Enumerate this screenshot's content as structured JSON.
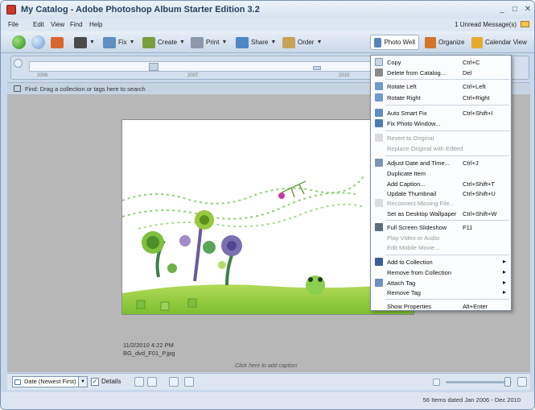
{
  "window": {
    "title": "My Catalog - Adobe Photoshop Album Starter Edition 3.2",
    "controls": [
      "_",
      "□",
      "✕"
    ]
  },
  "menubar": {
    "items": [
      "File",
      "Edit",
      "View",
      "Find",
      "Help"
    ],
    "unread": "1 Unread Message(s)"
  },
  "toolbar": {
    "fix": "Fix",
    "create": "Create",
    "print": "Print",
    "share": "Share",
    "order": "Order",
    "photo_well": "Photo Well",
    "organize": "Organize",
    "calendar_view": "Calendar View"
  },
  "timeline": {
    "years": [
      "2006",
      "2007",
      "2010"
    ]
  },
  "find": {
    "text": "Find: Drag a collection or tags here to search"
  },
  "photo": {
    "date": "11/2/2010 4:22 PM",
    "filename": "BG_dvd_F01_P.jpg",
    "caption_prompt": "Click here to add caption"
  },
  "bottombar": {
    "sort": "Date (Newest First)",
    "details": "Details",
    "details_checked": "✓"
  },
  "status": {
    "text": "56 Items dated Jan 2006 - Dec 2010"
  },
  "context_menu": {
    "items": [
      {
        "label": "Copy",
        "shortcut": "Ctrl+C",
        "enabled": true
      },
      {
        "label": "Delete from Catalog...",
        "shortcut": "Del",
        "enabled": true
      },
      {
        "label": "Rotate Left",
        "shortcut": "Ctrl+Left",
        "enabled": true
      },
      {
        "label": "Rotate Right",
        "shortcut": "Ctrl+Right",
        "enabled": true
      },
      {
        "label": "Auto Smart Fix",
        "shortcut": "Ctrl+Shift+I",
        "enabled": true
      },
      {
        "label": "Fix Photo Window...",
        "shortcut": "",
        "enabled": true
      },
      {
        "label": "Revert to Original",
        "shortcut": "",
        "enabled": false
      },
      {
        "label": "Replace Original with Edited",
        "shortcut": "",
        "enabled": false
      },
      {
        "label": "Adjust Date and Time...",
        "shortcut": "Ctrl+J",
        "enabled": true
      },
      {
        "label": "Duplicate Item",
        "shortcut": "",
        "enabled": true
      },
      {
        "label": "Add Caption...",
        "shortcut": "Ctrl+Shift+T",
        "enabled": true
      },
      {
        "label": "Update Thumbnail",
        "shortcut": "Ctrl+Shift+U",
        "enabled": true
      },
      {
        "label": "Reconnect Missing File...",
        "shortcut": "",
        "enabled": false
      },
      {
        "label": "Set as Desktop Wallpaper",
        "shortcut": "Ctrl+Shift+W",
        "enabled": true
      },
      {
        "label": "Full Screen Slideshow",
        "shortcut": "F11",
        "enabled": true
      },
      {
        "label": "Play Video or Audio",
        "shortcut": "",
        "enabled": false
      },
      {
        "label": "Edit Mobile Movie...",
        "shortcut": "",
        "enabled": false
      },
      {
        "label": "Add to Collection",
        "shortcut": "",
        "enabled": true,
        "submenu": "▸"
      },
      {
        "label": "Remove from Collection",
        "shortcut": "",
        "enabled": true,
        "submenu": "▸"
      },
      {
        "label": "Attach Tag",
        "shortcut": "",
        "enabled": true,
        "submenu": "▸"
      },
      {
        "label": "Remove Tag",
        "shortcut": "",
        "enabled": true,
        "submenu": "▸"
      },
      {
        "label": "Show Properties",
        "shortcut": "Alt+Enter",
        "enabled": true
      }
    ]
  }
}
